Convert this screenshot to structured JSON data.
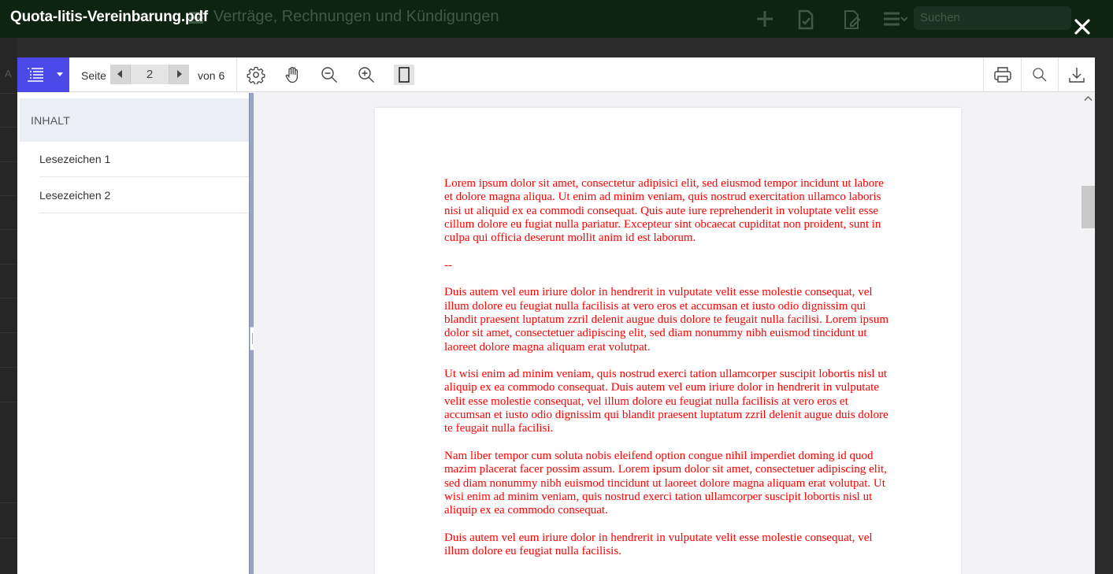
{
  "modal": {
    "file_title": "Quota-litis-Vereinbarung.pdf"
  },
  "background_app": {
    "title": "Verträge, Rechnungen und Kündigungen",
    "search_placeholder": "Suchen"
  },
  "toolbar": {
    "page_label": "Seite",
    "current_page": "2",
    "total_label": "von 6",
    "icons": [
      "outline-icon",
      "settings-icon",
      "hand-icon",
      "zoom-out-icon",
      "zoom-in-icon",
      "page-view-icon",
      "print-icon",
      "search-icon",
      "download-icon"
    ]
  },
  "sidebar": {
    "header": "INHALT",
    "bookmarks": [
      {
        "label": "Lesezeichen 1"
      },
      {
        "label": "Lesezeichen 2"
      }
    ]
  },
  "document": {
    "paragraphs": [
      "Lorem ipsum dolor sit amet, consectetur adipisici elit, sed eiusmod tempor incidunt ut labore et dolore magna aliqua. Ut enim ad minim veniam, quis nostrud exercitation ullamco laboris nisi ut aliquid ex ea commodi consequat. Quis aute iure reprehenderit in voluptate velit esse cillum dolore eu fugiat nulla pariatur. Excepteur sint obcaecat cupiditat non proident, sunt in culpa qui officia deserunt mollit anim id est laborum.",
      "--",
      "Duis autem vel eum iriure dolor in hendrerit in vulputate velit esse molestie consequat, vel illum dolore eu feugiat nulla facilisis at vero eros et accumsan et iusto odio dignissim qui blandit praesent luptatum zzril delenit augue duis dolore te feugait nulla facilisi. Lorem ipsum dolor sit amet, consectetuer adipiscing elit, sed diam nonummy nibh euismod tincidunt ut laoreet dolore magna aliquam erat volutpat.",
      "Ut wisi enim ad minim veniam, quis nostrud exerci tation ullamcorper suscipit lobortis nisl ut aliquip ex ea commodo consequat. Duis autem vel eum iriure dolor in hendrerit in vulputate velit esse molestie consequat, vel illum dolore eu feugiat nulla facilisis at vero eros et accumsan et iusto odio dignissim qui blandit praesent luptatum zzril delenit augue duis dolore te feugait nulla facilisi.",
      "Nam liber tempor cum soluta nobis eleifend option congue nihil imperdiet doming id quod mazim placerat facer possim assum. Lorem ipsum dolor sit amet, consectetuer adipiscing elit, sed diam nonummy nibh euismod tincidunt ut laoreet dolore magna aliquam erat volutpat. Ut wisi enim ad minim veniam, quis nostrud exerci tation ullamcorper suscipit lobortis nisl ut aliquip ex ea commodo consequat.",
      "Duis autem vel eum iriure dolor in hendrerit in vulputate velit esse molestie consequat, vel illum dolore eu feugiat nulla facilisis."
    ]
  },
  "colors": {
    "accent": "#4b4ae8",
    "document_text": "#ff0000",
    "background_header": "#0c2410",
    "sidebar_header_bg": "#eceef5"
  }
}
